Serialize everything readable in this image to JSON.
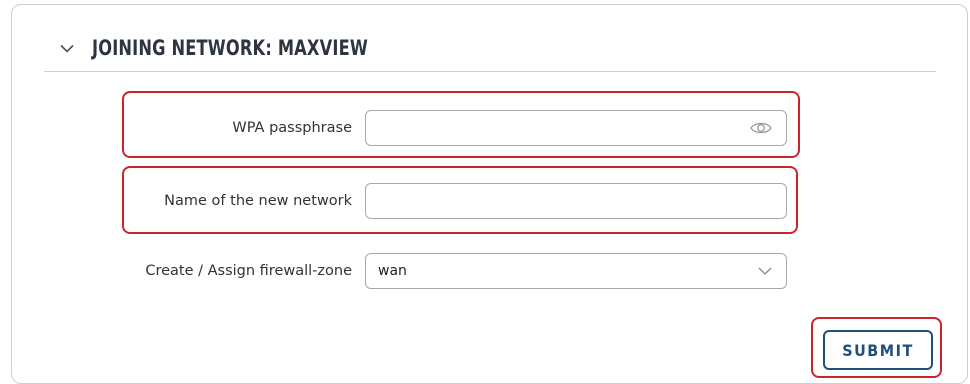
{
  "section": {
    "title": "JOINING NETWORK: MAXVIEW",
    "collapse_icon": "chevron-down-icon"
  },
  "form": {
    "wpa_passphrase": {
      "label": "WPA passphrase",
      "value": "",
      "icon": "eye-icon"
    },
    "network_name": {
      "label": "Name of the new network",
      "value": ""
    },
    "firewall_zone": {
      "label": "Create / Assign firewall-zone",
      "selected": "wan",
      "icon": "chevron-down-icon"
    }
  },
  "actions": {
    "submit_label": "SUBMIT"
  },
  "colors": {
    "highlight": "#c9252c",
    "button": "#1f4f7c",
    "border": "#a8a8a8"
  }
}
